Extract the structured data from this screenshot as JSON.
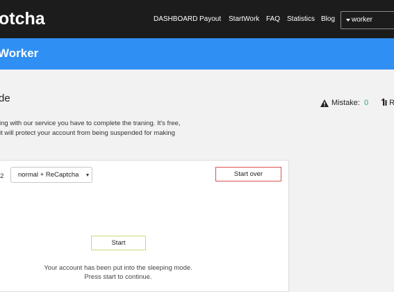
{
  "brand": "otcha",
  "nav": {
    "items": [
      "DASHBOARD",
      "Payout",
      "StartWork",
      "FAQ",
      "Statistics",
      "Blog"
    ],
    "user": "worker"
  },
  "header": {
    "title": "Worker"
  },
  "training": {
    "section_title": "de",
    "intro_line1": "ing with our service you have to complete the traning. It's free,",
    "intro_line2": "it will protect your account from being suspended for making"
  },
  "stats": {
    "mistake_label": "Mistake:",
    "mistake_value": "0",
    "reward_label": "R"
  },
  "panel": {
    "level_label": "-2",
    "select_value": "normal + ReCaptcha",
    "start_over_label": "Start over",
    "start_label": "Start",
    "message_line1": "Your account has been put into the sleeping mode.",
    "message_line2": "Press start to continue."
  },
  "icons": {
    "mistake": "warning-triangle-icon",
    "reward": "reward-icon",
    "dropdown_caret": "caret-down-icon"
  },
  "colors": {
    "navbar_bg": "#1c1c1c",
    "header_bg": "#2f8ff3",
    "page_bg": "#f2f2f2",
    "mistake_value": "#2aa870",
    "start_over_border": "#d9534f",
    "start_border": "#c9d97a"
  }
}
